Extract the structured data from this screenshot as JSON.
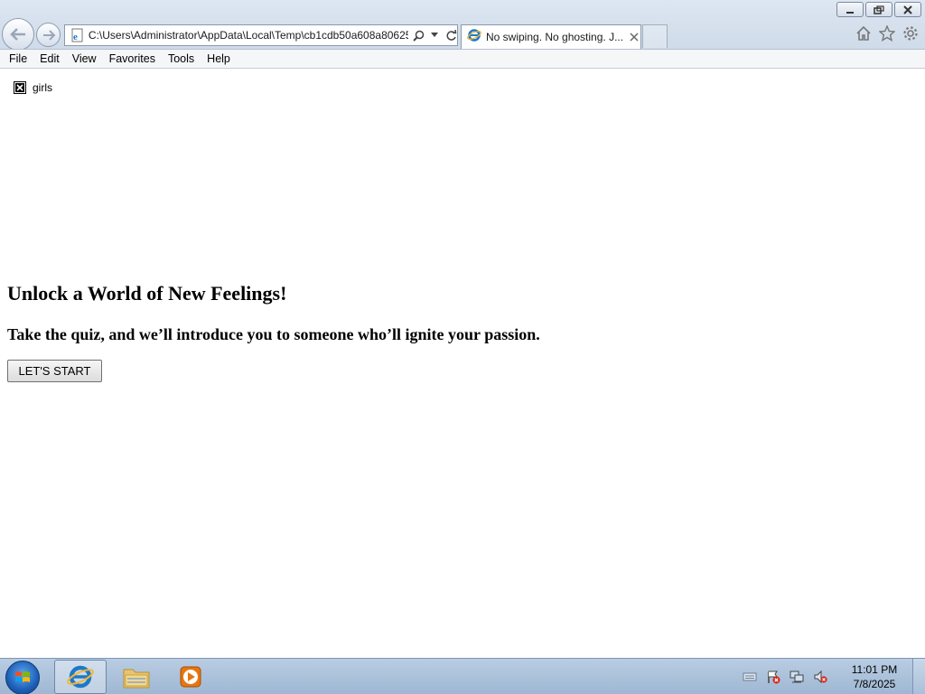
{
  "browser": {
    "address": "C:\\Users\\Administrator\\AppData\\Local\\Temp\\cb1cdb50a608a80625",
    "tab_title": "No swiping. No ghosting. J..."
  },
  "menu": [
    "File",
    "Edit",
    "View",
    "Favorites",
    "Tools",
    "Help"
  ],
  "page": {
    "broken_image_alt": "girls",
    "headline": "Unlock a World of New Feelings!",
    "subline": "Take the quiz, and we’ll introduce you to someone who’ll ignite your passion.",
    "start_button": "LET'S START"
  },
  "taskbar": {
    "time": "11:01 PM",
    "date": "7/8/2025"
  },
  "colors": {
    "chrome_top": "#dde6f1",
    "taskbar": "#a9bfd9",
    "ie_blue": "#1f78c8"
  }
}
